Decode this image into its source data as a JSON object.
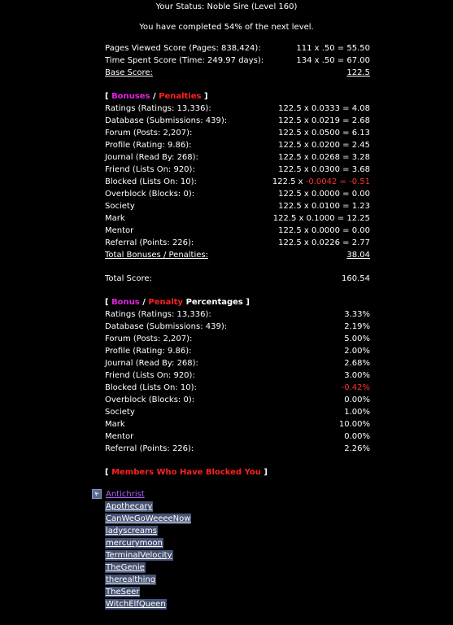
{
  "status_line": "Your Status: Noble Sire (Level 160)",
  "progress_line": "You have completed 54% of the next level.",
  "base": [
    {
      "label": "Pages Viewed Score (Pages: 838,424):",
      "value": "111 x .50 = 55.50"
    },
    {
      "label": "Time Spent Score (Time: 249.97 days):",
      "value": "134 x .50 = 67.00"
    },
    {
      "label": "Base Score:",
      "value": "122.5"
    }
  ],
  "bonus_header": {
    "open": "[ ",
    "bonus": "Bonuses",
    "sep": " / ",
    "penalty": "Penalties",
    "close": " ]"
  },
  "bonuses": [
    {
      "label": "Ratings (Ratings: 13,336):",
      "value": "122.5 x 0.0333 = 4.08"
    },
    {
      "label": "Database (Submissions: 439):",
      "value": "122.5 x 0.0219 = 2.68"
    },
    {
      "label": "Forum (Posts: 2,207):",
      "value": "122.5 x 0.0500 = 6.13"
    },
    {
      "label": "Profile (Rating: 9.86):",
      "value": "122.5 x 0.0200 = 2.45"
    },
    {
      "label": "Journal (Read By: 268):",
      "value": "122.5 x 0.0268 = 3.28"
    },
    {
      "label": "Friend (Lists On: 920):",
      "value": "122.5 x 0.0300 = 3.68"
    },
    {
      "label": "Blocked (Lists On: 10):",
      "value_prefix": "122.5 x ",
      "value_neg1": "-0.0042",
      "value_mid": " = ",
      "value_neg2": "-0.51"
    },
    {
      "label": "Overblock (Blocks: 0):",
      "value": "122.5 x 0.0000 = 0.00"
    },
    {
      "label": "Society",
      "value": "122.5 x 0.0100 = 1.23"
    },
    {
      "label": "Mark",
      "value": "122.5 x 0.1000 = 12.25"
    },
    {
      "label": "Mentor",
      "value": "122.5 x 0.0000 = 0.00"
    },
    {
      "label": "Referral (Points: 226):",
      "value": "122.5 x 0.0226 = 2.77"
    },
    {
      "label": "Total Bonuses / Penalties:",
      "value": "38.04"
    }
  ],
  "total": {
    "label": "Total Score:",
    "value": "160.54"
  },
  "pct_header": {
    "open": "[ ",
    "bonus": "Bonus",
    "sep": " / ",
    "penalty": "Penalty",
    "tail": " Percentages",
    "close": " ]"
  },
  "percentages": [
    {
      "label": "Ratings (Ratings: 13,336):",
      "value": "3.33%"
    },
    {
      "label": "Database (Submissions: 439):",
      "value": "2.19%"
    },
    {
      "label": "Forum (Posts: 2,207):",
      "value": "5.00%"
    },
    {
      "label": "Profile (Rating: 9.86):",
      "value": "2.00%"
    },
    {
      "label": "Journal (Read By: 268):",
      "value": "2.68%"
    },
    {
      "label": "Friend (Lists On: 920):",
      "value": "3.00%"
    },
    {
      "label": "Blocked (Lists On: 10):",
      "value": "-0.42%"
    },
    {
      "label": "Overblock (Blocks: 0):",
      "value": "0.00%"
    },
    {
      "label": "Society",
      "value": "1.00%"
    },
    {
      "label": "Mark",
      "value": "10.00%"
    },
    {
      "label": "Mentor",
      "value": "0.00%"
    },
    {
      "label": "Referral (Points: 226):",
      "value": "2.26%"
    }
  ],
  "blocked_header": {
    "open": "[ ",
    "title": "Members Who Have Blocked You",
    "close": " ]"
  },
  "blocked_by": [
    "Antichrist",
    "Apothecary",
    "CanWeGoWeeeeNow",
    "ladyscreams",
    "mercurymoon",
    "TerminalVelocity",
    "TheGenie",
    "therealthing",
    "TheSeer",
    "WitchElfQueen"
  ],
  "colors": {
    "background": "#000000",
    "bonus": "#e020e0",
    "penalty": "#ff2020",
    "link_bg": "#455273"
  }
}
